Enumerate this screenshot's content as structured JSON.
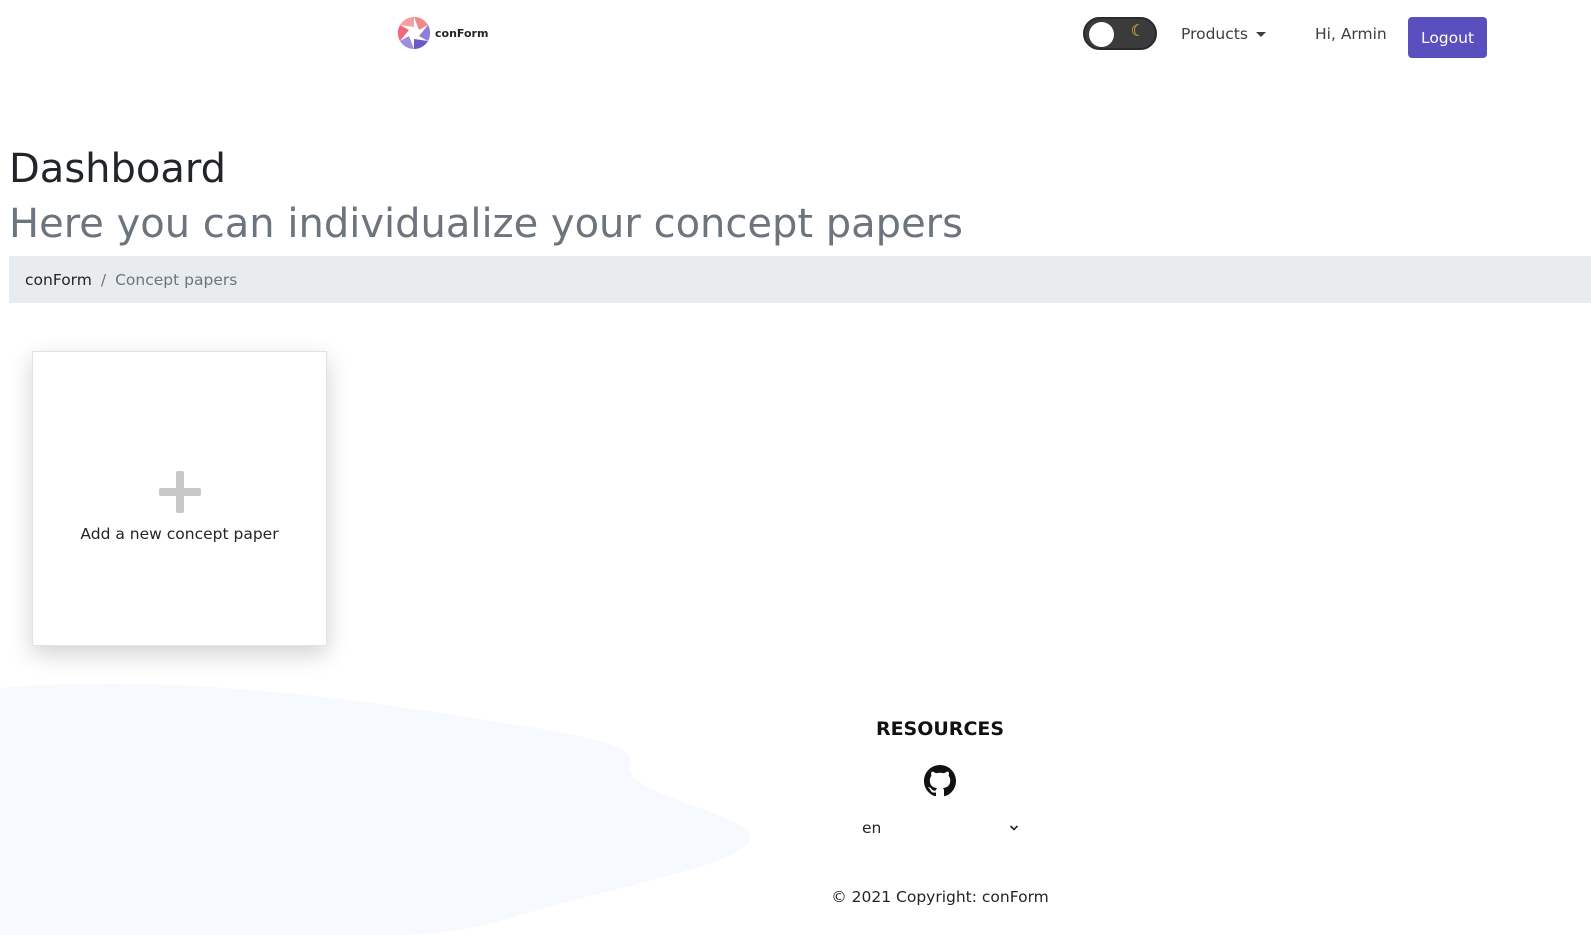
{
  "navbar": {
    "brand_name": "conForm",
    "theme_toggle_icon": "moon-icon",
    "products_label": "Products",
    "greeting": "Hi, Armin",
    "logout_label": "Logout",
    "accent_color": "#5a4fbf"
  },
  "header": {
    "title": "Dashboard",
    "subtitle": "Here you can individualize your concept papers"
  },
  "breadcrumb": {
    "items": [
      {
        "label": "conForm"
      },
      {
        "label": "Concept papers"
      }
    ],
    "separator": "/"
  },
  "main": {
    "add_card_label": "Add a new concept paper",
    "add_icon": "plus-icon"
  },
  "footer": {
    "heading": "RESOURCES",
    "github_icon": "github-icon",
    "language": "en",
    "copyright": "© 2021 Copyright: conForm"
  }
}
